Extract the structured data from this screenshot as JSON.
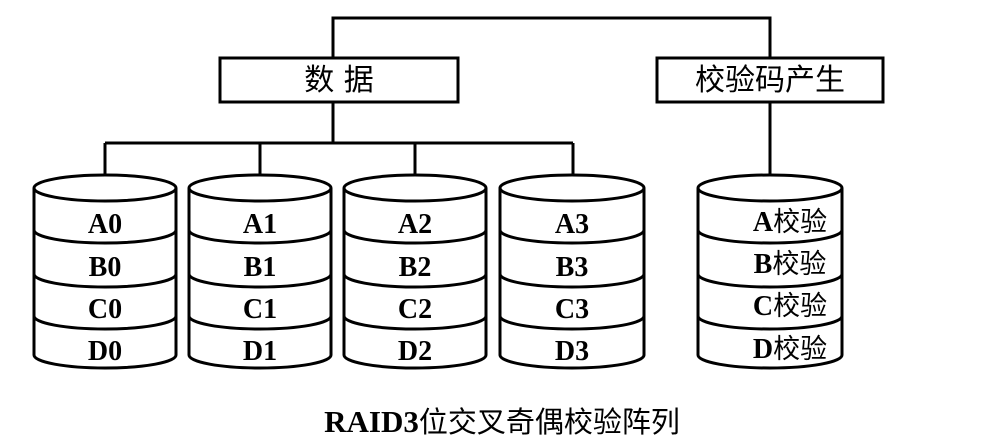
{
  "boxes": {
    "data_label": "数 据",
    "parity_gen_label": "校验码产生"
  },
  "disks": [
    {
      "cells": [
        "A0",
        "B0",
        "C0",
        "D0"
      ]
    },
    {
      "cells": [
        "A1",
        "B1",
        "C1",
        "D1"
      ]
    },
    {
      "cells": [
        "A2",
        "B2",
        "C2",
        "D2"
      ]
    },
    {
      "cells": [
        "A3",
        "B3",
        "C3",
        "D3"
      ]
    }
  ],
  "parity_disk": {
    "cells": [
      {
        "letter": "A",
        "suffix": "校验"
      },
      {
        "letter": "B",
        "suffix": "校验"
      },
      {
        "letter": "C",
        "suffix": "校验"
      },
      {
        "letter": "D",
        "suffix": "校验"
      }
    ]
  },
  "caption": {
    "prefix": "RAID3",
    "text": "位交叉奇偶校验阵列"
  }
}
